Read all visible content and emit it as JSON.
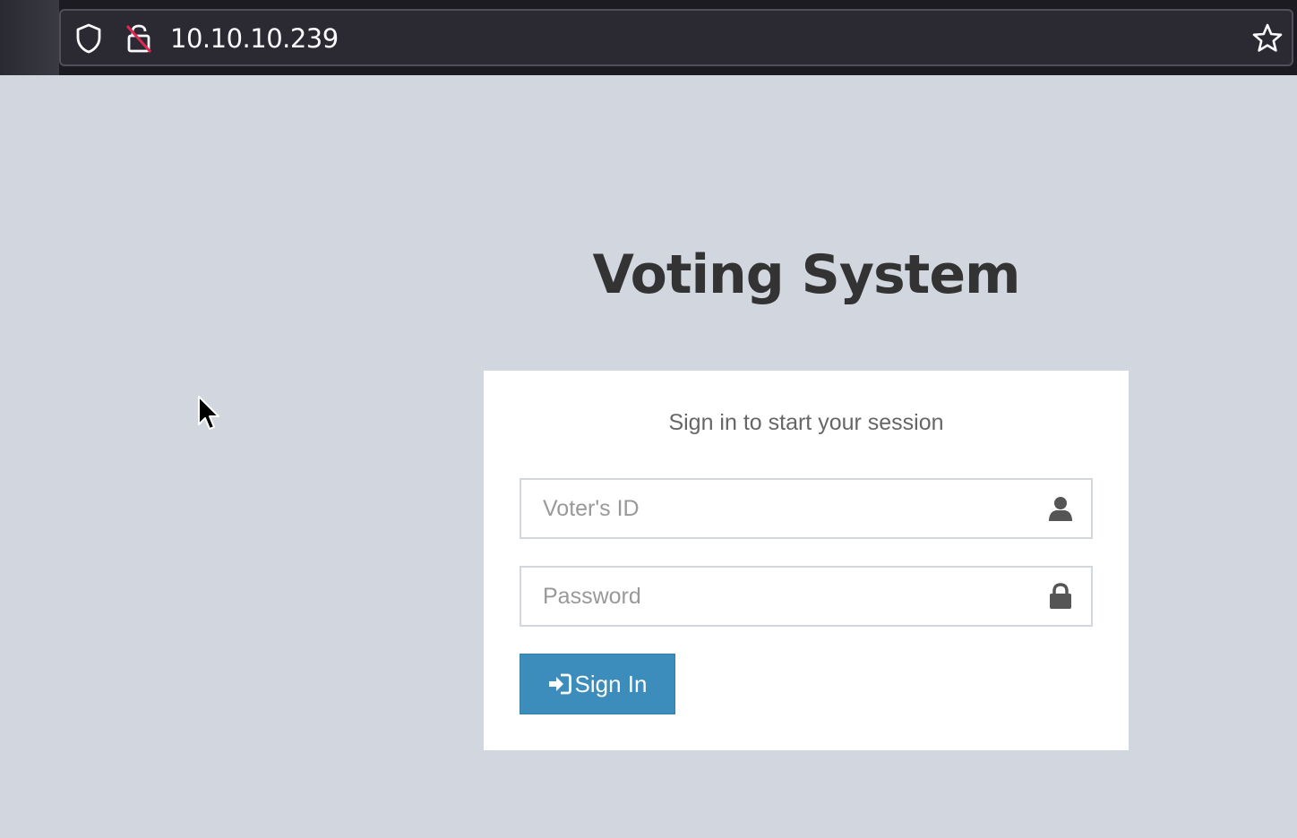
{
  "browser": {
    "url": "10.10.10.239"
  },
  "page": {
    "title": "Voting System",
    "login_message": "Sign in to start your session",
    "voter_id_placeholder": "Voter's ID",
    "password_placeholder": "Password",
    "sign_in_label": "Sign In"
  },
  "colors": {
    "background": "#d2d6de",
    "button": "#3c8dbc",
    "box": "#ffffff"
  },
  "icons": {
    "url_bar": [
      "shield-icon",
      "lock-broken-icon",
      "star-icon"
    ],
    "voter_field": "user-icon",
    "password_field": "lock-icon",
    "button": "sign-in-icon"
  }
}
